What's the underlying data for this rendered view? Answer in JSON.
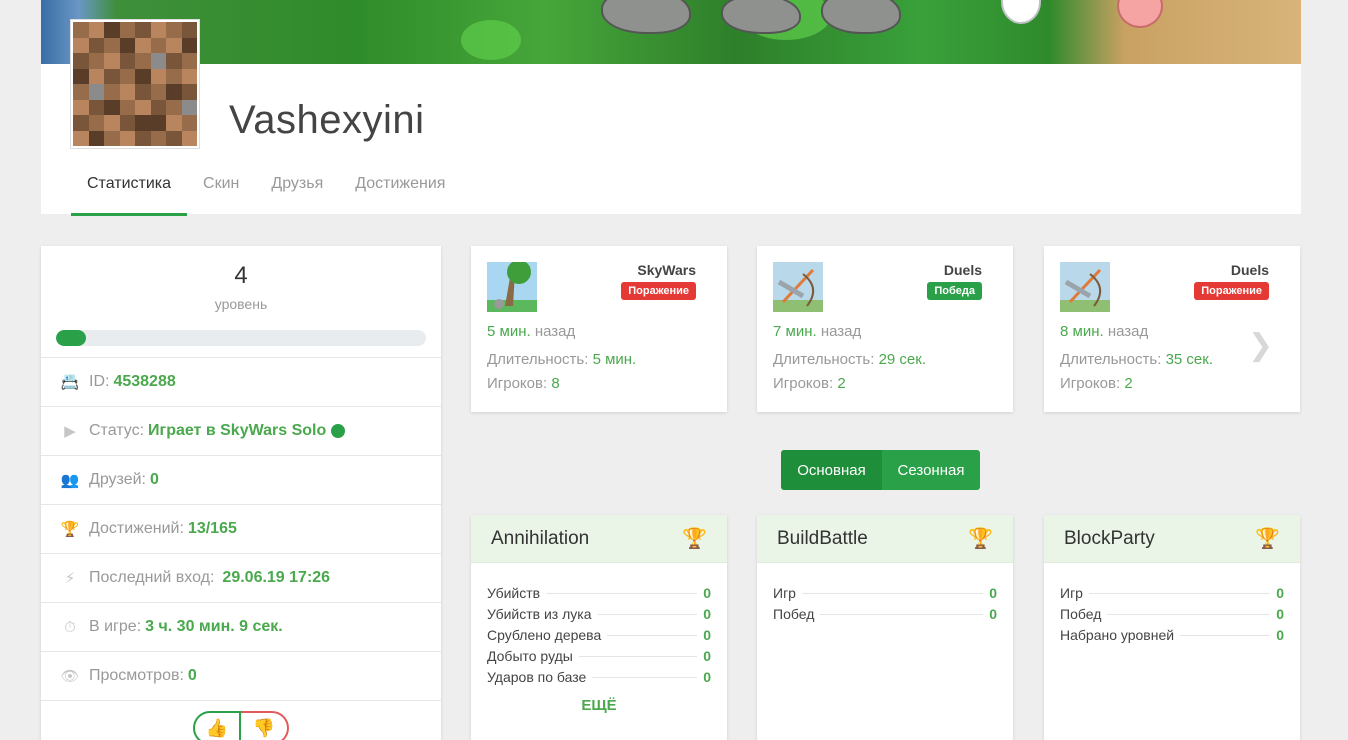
{
  "profile": {
    "username": "Vashexyini",
    "tabs": [
      "Статистика",
      "Скин",
      "Друзья",
      "Достижения"
    ]
  },
  "level": {
    "value": "4",
    "label": "уровень",
    "progress": 0.08
  },
  "stats": {
    "id_label": "ID:",
    "id_value": "4538288",
    "status_label": "Статус:",
    "status_value": "Играет в SkyWars Solo",
    "friends_label": "Друзей:",
    "friends_value": "0",
    "achievements_label": "Достижений:",
    "achievements_value": "13/165",
    "lastlogin_label": "Последний вход:",
    "lastlogin_value": "29.06.19 17:26",
    "ingame_label": "В игре:",
    "ingame_value": "3 ч. 30 мин. 9 сек.",
    "views_label": "Просмотров:",
    "views_value": "0"
  },
  "recent_games": [
    {
      "mode": "SkyWars",
      "result": "Поражение",
      "ago_value": "5 мин.",
      "ago_suffix": "назад",
      "duration_label": "Длительность:",
      "duration_value": "5 мин.",
      "players_label": "Игроков:",
      "players_value": "8"
    },
    {
      "mode": "Duels",
      "result": "Победа",
      "ago_value": "7 мин.",
      "ago_suffix": "назад",
      "duration_label": "Длительность:",
      "duration_value": "29 сек.",
      "players_label": "Игроков:",
      "players_value": "2"
    },
    {
      "mode": "Duels",
      "result": "Поражение",
      "ago_value": "8 мин.",
      "ago_suffix": "назад",
      "duration_label": "Длительность:",
      "duration_value": "35 сек.",
      "players_label": "Игроков:",
      "players_value": "2"
    }
  ],
  "stat_toggle": {
    "main": "Основная",
    "seasonal": "Сезонная"
  },
  "game_cards": [
    {
      "title": "Annihilation",
      "rows": [
        {
          "label": "Убийств",
          "value": "0"
        },
        {
          "label": "Убийств из лука",
          "value": "0"
        },
        {
          "label": "Срублено дерева",
          "value": "0"
        },
        {
          "label": "Добыто руды",
          "value": "0"
        },
        {
          "label": "Ударов по базе",
          "value": "0"
        }
      ],
      "more": "ЕЩЁ"
    },
    {
      "title": "BuildBattle",
      "rows": [
        {
          "label": "Игр",
          "value": "0"
        },
        {
          "label": "Побед",
          "value": "0"
        }
      ]
    },
    {
      "title": "BlockParty",
      "rows": [
        {
          "label": "Игр",
          "value": "0"
        },
        {
          "label": "Побед",
          "value": "0"
        },
        {
          "label": "Набрано уровней",
          "value": "0"
        }
      ]
    }
  ],
  "colors": {
    "accent": "#2aa149",
    "loss": "#e53935",
    "value_green": "#4aa84d",
    "trophy": "#f1a81b"
  }
}
